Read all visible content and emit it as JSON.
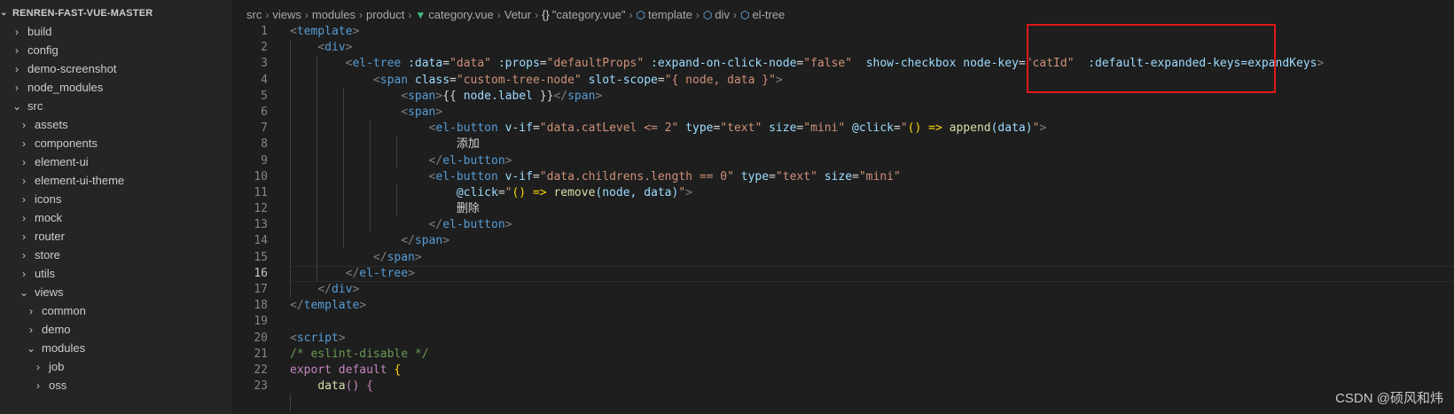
{
  "explorer": {
    "title": "RENREN-FAST-VUE-MASTER",
    "items": [
      {
        "label": "build",
        "chevron": "›"
      },
      {
        "label": "config",
        "chevron": "›"
      },
      {
        "label": "demo-screenshot",
        "chevron": "›"
      },
      {
        "label": "node_modules",
        "chevron": "›"
      },
      {
        "label": "src",
        "chevron": "⌄"
      },
      {
        "label": "assets",
        "chevron": "›"
      },
      {
        "label": "components",
        "chevron": "›"
      },
      {
        "label": "element-ui",
        "chevron": "›"
      },
      {
        "label": "element-ui-theme",
        "chevron": "›"
      },
      {
        "label": "icons",
        "chevron": "›"
      },
      {
        "label": "mock",
        "chevron": "›"
      },
      {
        "label": "router",
        "chevron": "›"
      },
      {
        "label": "store",
        "chevron": "›"
      },
      {
        "label": "utils",
        "chevron": "›"
      },
      {
        "label": "views",
        "chevron": "⌄"
      },
      {
        "label": "common",
        "chevron": "›"
      },
      {
        "label": "demo",
        "chevron": "›"
      },
      {
        "label": "modules",
        "chevron": "⌄"
      },
      {
        "label": "job",
        "chevron": "›"
      },
      {
        "label": "oss",
        "chevron": "›"
      }
    ]
  },
  "breadcrumb": {
    "parts": [
      "src",
      "views",
      "modules",
      "product"
    ],
    "file": "category.vue",
    "vetur": "Vetur",
    "braces": "{}",
    "vetur_file": "\"category.vue\"",
    "template": "template",
    "div": "div",
    "eltree": "el-tree"
  },
  "editor": {
    "line_numbers": [
      "1",
      "2",
      "3",
      "4",
      "5",
      "6",
      "7",
      "8",
      "9",
      "10",
      "11",
      "12",
      "13",
      "14",
      "15",
      "16",
      "17",
      "18",
      "19",
      "20",
      "21",
      "22",
      "23"
    ],
    "active_line": "16",
    "tokens": {
      "template": "template",
      "div": "div",
      "el_tree": "el-tree",
      "data_attr": ":data",
      "data_val": "\"data\"",
      "props_attr": ":props",
      "props_val": "\"defaultProps\"",
      "expand_attr": ":expand-on-click-node",
      "expand_val": "\"false\"",
      "checkbox_attr": "show-checkbox",
      "nodekey_attr": "node-key",
      "nodekey_val": "\"catId\"",
      "default_expanded": ":default-expanded-keys=expandKeys",
      "span": "span",
      "class_attr": "class",
      "class_val": "\"custom-tree-node\"",
      "slotscope_attr": "slot-scope",
      "slotscope_val": "\"{ node, data }\"",
      "mustache_open": "{{",
      "node_label": "node.label",
      "mustache_close": "}}",
      "el_button": "el-button",
      "vif_attr": "v-if",
      "vif1_val": "\"data.catLevel <= 2\"",
      "type_attr": "type",
      "type_val": "\"text\"",
      "size_attr": "size",
      "size_val": "\"mini\"",
      "click_attr": "@click",
      "q": "\"",
      "arrow_fn_open": "() =>",
      "append": "append",
      "append_args": "(data)",
      "add_text": "添加",
      "vif2_val": "\"data.childrens.length == 0\"",
      "remove": "remove",
      "remove_args": "(node, data)",
      "delete_text": "删除",
      "script": "script",
      "comment": "/* eslint-disable */",
      "export": "export",
      "default": "default",
      "brace_open": "{",
      "data_fn": "data",
      "paren": "()"
    }
  },
  "watermark": "CSDN @硕风和炜",
  "colors": {
    "highlight_box": "#e0191c",
    "tag": "#569cd6",
    "attribute": "#9cdcfe",
    "string": "#ce9178"
  }
}
